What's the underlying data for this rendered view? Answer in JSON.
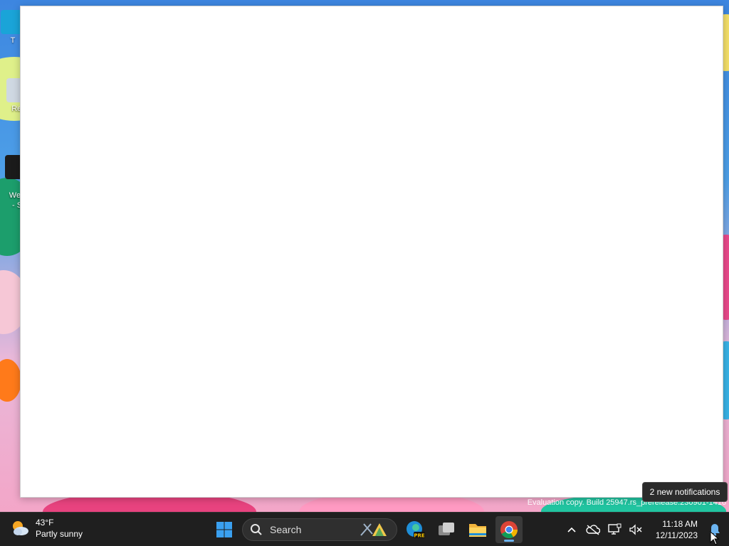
{
  "desktop": {
    "icons": [
      {
        "label": "T",
        "icon": "desktop-app-icon"
      },
      {
        "label": "Rec",
        "icon": "recycle-bin-icon"
      },
      {
        "label": "Web\n- S",
        "icon": "shortcut-icon"
      }
    ]
  },
  "window": {
    "title": ""
  },
  "watermark": {
    "text": "Evaluation copy. Build 25947.rs_prerelease.230901-1416"
  },
  "tooltip": {
    "text": "2 new notifications"
  },
  "taskbar": {
    "weather": {
      "temperature": "43°F",
      "condition": "Partly sunny",
      "icon": "partly-sunny-icon"
    },
    "start": {
      "icon": "windows-start-icon"
    },
    "search": {
      "label": "Search",
      "icon": "search-icon",
      "highlight_icon": "search-highlight-icon"
    },
    "apps": [
      {
        "name": "Microsoft Edge Preview",
        "icon": "edge-pre-icon",
        "badge": "PRE"
      },
      {
        "name": "Task View",
        "icon": "task-view-icon"
      },
      {
        "name": "File Explorer",
        "icon": "folder-icon"
      },
      {
        "name": "Google Chrome",
        "icon": "chrome-icon",
        "active": true
      }
    ],
    "tray": {
      "icons": [
        "chevron-up-icon",
        "onedrive-offline-icon",
        "network-icon",
        "volume-muted-icon"
      ],
      "time": "11:18 AM",
      "date": "12/11/2023",
      "notification_icon": "bell-icon"
    }
  },
  "colors": {
    "taskbar_bg": "#1f1f1f",
    "accent": "#6cb4f0",
    "window_bg": "#ffffff"
  }
}
